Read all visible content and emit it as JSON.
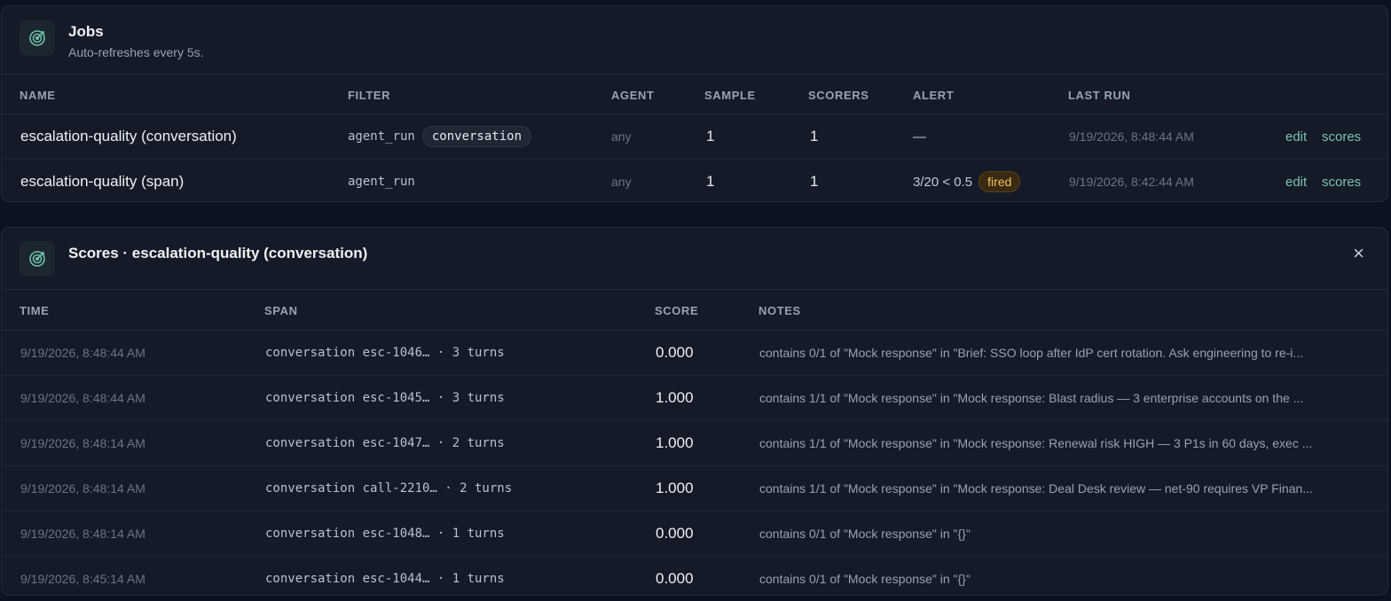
{
  "jobs": {
    "title": "Jobs",
    "subtitle": "Auto-refreshes every 5s.",
    "icon": "target-icon",
    "columns": [
      "NAME",
      "FILTER",
      "AGENT",
      "SAMPLE",
      "SCORERS",
      "ALERT",
      "LAST RUN"
    ],
    "rows": [
      {
        "name": "escalation-quality (conversation)",
        "filter": "agent_run",
        "filter_tag": "conversation",
        "agent": "any",
        "sample": "1",
        "scorers": "1",
        "alert": "—",
        "alert_badge": "",
        "last_run": "9/19/2026, 8:48:44 AM",
        "edit": "edit",
        "scores": "scores"
      },
      {
        "name": "escalation-quality (span)",
        "filter": "agent_run",
        "filter_tag": "",
        "agent": "any",
        "sample": "1",
        "scorers": "1",
        "alert": "3/20 < 0.5",
        "alert_badge": "fired",
        "last_run": "9/19/2026, 8:42:44 AM",
        "edit": "edit",
        "scores": "scores"
      }
    ]
  },
  "scores": {
    "title": "Scores · escalation-quality (conversation)",
    "icon": "target-icon",
    "close": "×",
    "columns": [
      "TIME",
      "SPAN",
      "SCORE",
      "NOTES"
    ],
    "rows": [
      {
        "time": "9/19/2026, 8:48:44 AM",
        "span": "conversation esc-1046… · 3 turns",
        "score": "0.000",
        "notes": "contains 0/1 of \"Mock response\" in \"Brief: SSO loop after IdP cert rotation. Ask engineering to re-i..."
      },
      {
        "time": "9/19/2026, 8:48:44 AM",
        "span": "conversation esc-1045… · 3 turns",
        "score": "1.000",
        "notes": "contains 1/1 of \"Mock response\" in \"Mock response: Blast radius — 3 enterprise accounts on the ..."
      },
      {
        "time": "9/19/2026, 8:48:14 AM",
        "span": "conversation esc-1047… · 2 turns",
        "score": "1.000",
        "notes": "contains 1/1 of \"Mock response\" in \"Mock response: Renewal risk HIGH — 3 P1s in 60 days, exec ..."
      },
      {
        "time": "9/19/2026, 8:48:14 AM",
        "span": "conversation call-2210… · 2 turns",
        "score": "1.000",
        "notes": "contains 1/1 of \"Mock response\" in \"Mock response: Deal Desk review — net-90 requires VP Finan..."
      },
      {
        "time": "9/19/2026, 8:48:14 AM",
        "span": "conversation esc-1048… · 1 turns",
        "score": "0.000",
        "notes": "contains 0/1 of \"Mock response\" in \"{}\""
      },
      {
        "time": "9/19/2026, 8:45:14 AM",
        "span": "conversation esc-1044… · 1 turns",
        "score": "0.000",
        "notes": "contains 0/1 of \"Mock response\" in \"{}\""
      }
    ]
  },
  "colors": {
    "accent": "#7cc4b0",
    "badge_text": "#f2c15a",
    "background": "#0d1220",
    "card": "#141a27"
  }
}
